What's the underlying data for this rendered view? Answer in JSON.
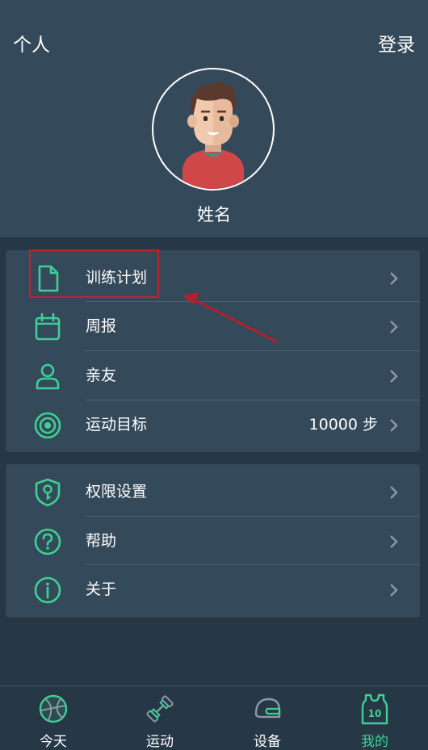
{
  "header": {
    "title": "个人",
    "login": "登录",
    "username": "姓名"
  },
  "menu_main": [
    {
      "label": "训练计划",
      "icon": "document-icon"
    },
    {
      "label": "周报",
      "icon": "calendar-icon"
    },
    {
      "label": "亲友",
      "icon": "person-icon"
    },
    {
      "label": "运动目标",
      "icon": "target-icon",
      "value": "10000 步"
    }
  ],
  "menu_settings": [
    {
      "label": "权限设置",
      "icon": "shield-key-icon"
    },
    {
      "label": "帮助",
      "icon": "question-circle-icon"
    },
    {
      "label": "关于",
      "icon": "info-circle-icon"
    }
  ],
  "tabs": [
    {
      "label": "今天",
      "icon": "basketball-icon"
    },
    {
      "label": "运动",
      "icon": "dumbbell-icon"
    },
    {
      "label": "设备",
      "icon": "helmet-icon"
    },
    {
      "label": "我的",
      "icon": "jersey-icon",
      "active": true,
      "badge": "10"
    }
  ],
  "colors": {
    "accent": "#3ed095",
    "background": "#263746",
    "card": "#34495a",
    "annotation": "#c0232d"
  }
}
